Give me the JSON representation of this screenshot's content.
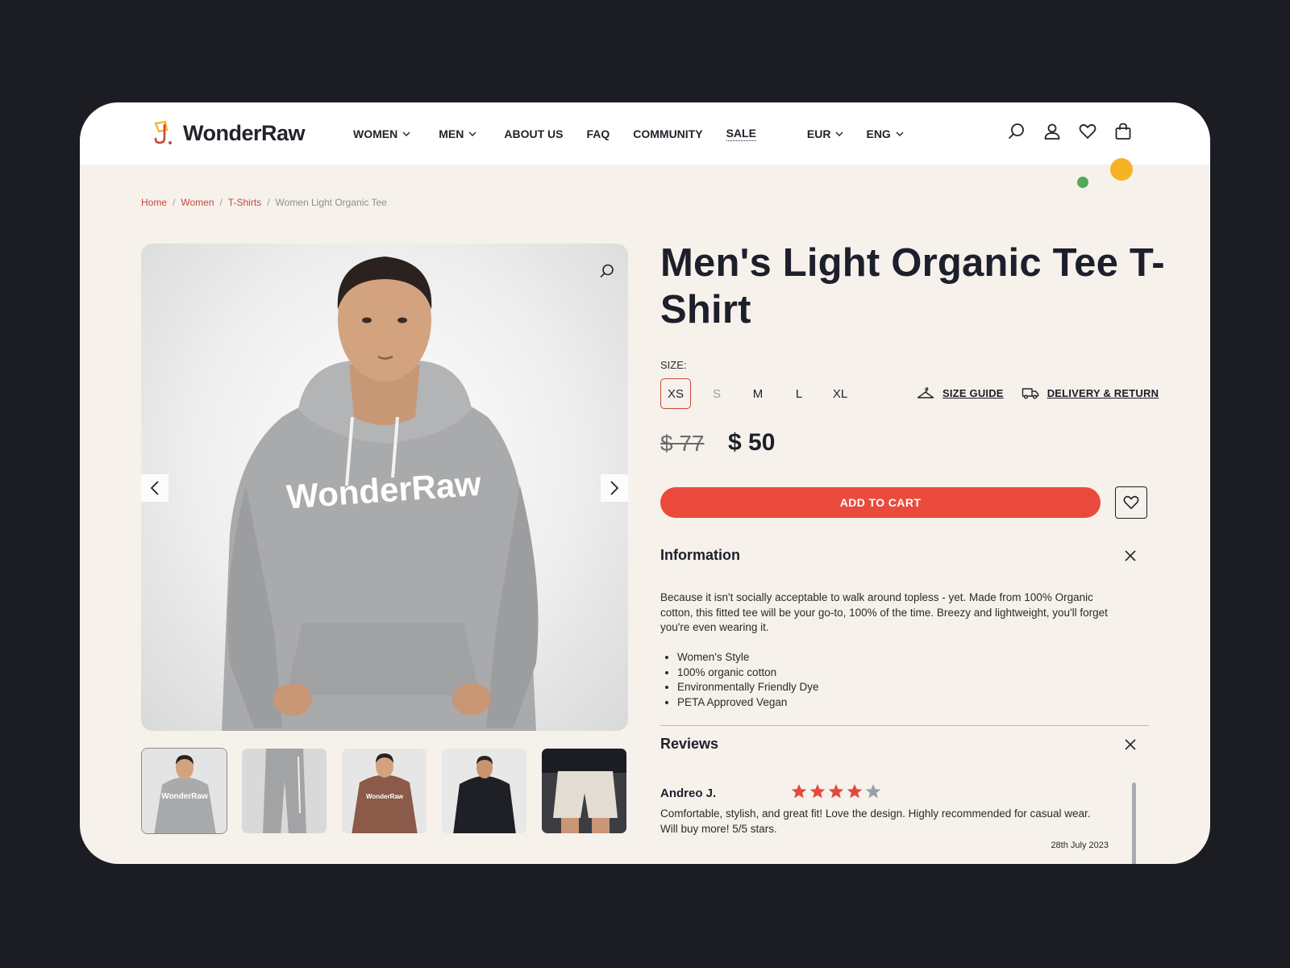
{
  "brand": {
    "name": "WonderRaw"
  },
  "nav": {
    "items": [
      {
        "label": "WOMEN",
        "dropdown": true
      },
      {
        "label": "MEN",
        "dropdown": true
      },
      {
        "label": "ABOUT US",
        "dropdown": false
      },
      {
        "label": "FAQ",
        "dropdown": false
      },
      {
        "label": "COMMUNITY",
        "dropdown": false
      },
      {
        "label": "SALE",
        "dropdown": false
      }
    ],
    "currency": "EUR",
    "language": "ENG",
    "icons": [
      "search-icon",
      "user-icon",
      "heart-icon",
      "bag-icon"
    ]
  },
  "breadcrumb": {
    "links": [
      "Home",
      "Women",
      "T-Shirts"
    ],
    "current": "Women Light Organic Tee"
  },
  "gallery": {
    "thumbnail_count": 5,
    "active_index": 0
  },
  "product": {
    "title": "Men's Light Organic Tee T-Shirt",
    "size_label": "SIZE:",
    "sizes": [
      {
        "label": "XS",
        "selected": true,
        "available": true
      },
      {
        "label": "S",
        "selected": false,
        "available": false
      },
      {
        "label": "M",
        "selected": false,
        "available": true
      },
      {
        "label": "L",
        "selected": false,
        "available": true
      },
      {
        "label": "XL",
        "selected": false,
        "available": true
      }
    ],
    "size_guide_label": "SIZE GUIDE",
    "delivery_label": "DELIVERY & RETURN",
    "price_old": "$ 77",
    "price_new": "$ 50",
    "add_to_cart_label": "ADD TO CART"
  },
  "information": {
    "title": "Information",
    "text": "Because it isn't socially acceptable to walk around topless - yet. Made from 100% Organic cotton, this fitted tee will be your go-to, 100% of the time. Breezy and lightweight, you'll forget you're even wearing it.",
    "bullets": [
      "Women's Style",
      "100% organic cotton",
      "Environmentally Friendly Dye",
      "PETA Approved Vegan"
    ]
  },
  "reviews": {
    "title": "Reviews",
    "items": [
      {
        "author": "Andreo J.",
        "rating": 4,
        "max_rating": 5,
        "text": "Comfortable, stylish, and great fit! Love the design. Highly recommended for casual wear. Will buy more! 5/5 stars.",
        "date": "28th July 2023"
      }
    ]
  },
  "colors": {
    "accent": "#ea4a3c",
    "link": "#c9473a",
    "background": "#f6f1eb",
    "dark": "#1d1f2c",
    "star": "#e4483b",
    "star_empty": "#9aa0a8"
  }
}
